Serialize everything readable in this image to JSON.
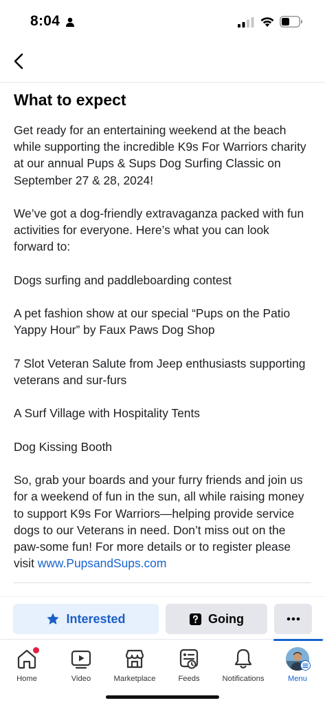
{
  "status_bar": {
    "time": "8:04"
  },
  "event": {
    "section_title": "What to expect",
    "paragraphs": [
      "Get ready for an entertaining weekend at the beach while supporting the incredible K9s For Warriors charity at our annual Pups & Sups Dog Surfing Classic on September 27 & 28, 2024!",
      "We’ve got a dog-friendly extravaganza packed with fun activities for everyone. Here’s what you can look forward to:",
      "Dogs surfing and paddleboarding contest",
      "A pet fashion show at our special “Pups on the Patio Yappy Hour” by Faux Paws Dog Shop",
      "7 Slot Veteran Salute from Jeep enthusiasts supporting veterans and sur-furs",
      "A Surf Village with Hospitality Tents",
      "Dog Kissing Booth"
    ],
    "closing_text": "So, grab your boards and your furry friends and join us for a weekend of fun in the sun, all while raising money to support K9s For Warriors—helping provide service dogs to our Veterans in need. Don’t miss out on the paw-some fun!  For more details or to register please visit ",
    "link_text": "www.PupsandSups.com"
  },
  "actions": {
    "interested_label": "Interested",
    "going_label": "Going",
    "more_label": "···"
  },
  "tabs": [
    {
      "label": "Home",
      "icon": "home-icon"
    },
    {
      "label": "Video",
      "icon": "video-icon"
    },
    {
      "label": "Marketplace",
      "icon": "marketplace-icon"
    },
    {
      "label": "Feeds",
      "icon": "feeds-icon"
    },
    {
      "label": "Notifications",
      "icon": "bell-icon"
    },
    {
      "label": "Menu",
      "icon": "avatar"
    }
  ],
  "colors": {
    "accent": "#1763cf",
    "interested_bg": "#e7f0fd",
    "notification_dot": "#e41e3f"
  }
}
